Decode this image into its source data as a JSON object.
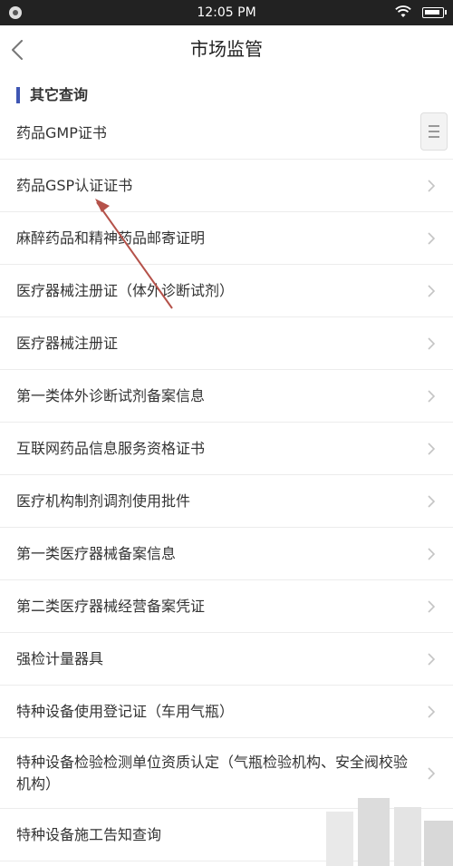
{
  "status_bar": {
    "time": "12:05 PM"
  },
  "nav": {
    "title": "市场监管"
  },
  "section": {
    "title": "其它查询",
    "accent_color": "#3f56b3"
  },
  "items": [
    {
      "label": "药品GMP证书"
    },
    {
      "label": "药品GSP认证证书"
    },
    {
      "label": "麻醉药品和精神药品邮寄证明"
    },
    {
      "label": "医疗器械注册证（体外诊断试剂）"
    },
    {
      "label": "医疗器械注册证"
    },
    {
      "label": "第一类体外诊断试剂备案信息"
    },
    {
      "label": "互联网药品信息服务资格证书"
    },
    {
      "label": "医疗机构制剂调剂使用批件"
    },
    {
      "label": "第一类医疗器械备案信息"
    },
    {
      "label": "第二类医疗器械经营备案凭证"
    },
    {
      "label": "强检计量器具"
    },
    {
      "label": "特种设备使用登记证（车用气瓶）"
    },
    {
      "label": "特种设备检验检测单位资质认定（气瓶检验机构、安全阀校验机构）"
    },
    {
      "label": "特种设备施工告知查询"
    }
  ],
  "annotation": {
    "arrow_color": "#b5524a"
  }
}
